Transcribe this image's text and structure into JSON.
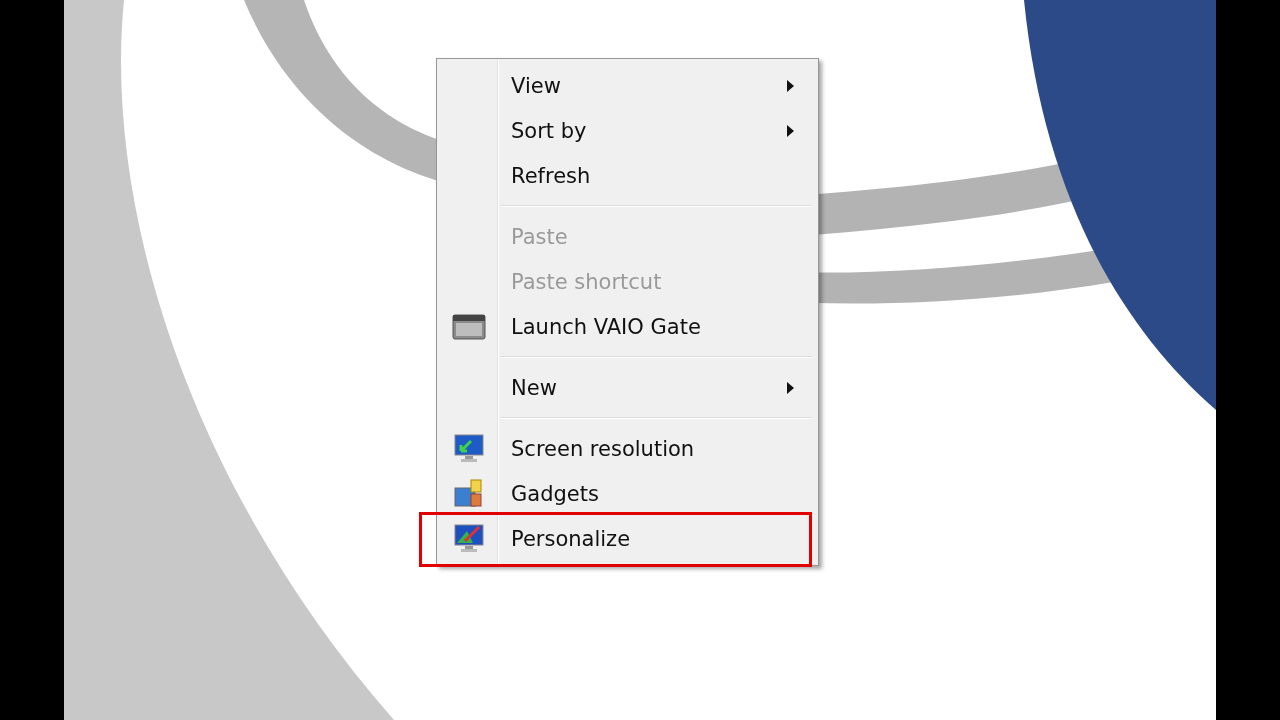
{
  "context_menu": {
    "items": [
      {
        "kind": "item",
        "label": "View",
        "submenu": true,
        "disabled": false,
        "highlighted": false
      },
      {
        "kind": "item",
        "label": "Sort by",
        "submenu": true,
        "disabled": false,
        "highlighted": false
      },
      {
        "kind": "item",
        "label": "Refresh",
        "submenu": false,
        "disabled": false,
        "highlighted": false
      },
      {
        "kind": "separator"
      },
      {
        "kind": "item",
        "label": "Paste",
        "submenu": false,
        "disabled": true,
        "highlighted": false
      },
      {
        "kind": "item",
        "label": "Paste shortcut",
        "submenu": false,
        "disabled": true,
        "highlighted": false
      },
      {
        "kind": "item",
        "label": "Launch VAIO Gate",
        "submenu": false,
        "disabled": false,
        "highlighted": false
      },
      {
        "kind": "separator"
      },
      {
        "kind": "item",
        "label": "New",
        "submenu": true,
        "disabled": false,
        "highlighted": false
      },
      {
        "kind": "separator"
      },
      {
        "kind": "item",
        "label": "Screen resolution",
        "submenu": false,
        "disabled": false,
        "highlighted": false
      },
      {
        "kind": "item",
        "label": "Gadgets",
        "submenu": false,
        "disabled": false,
        "highlighted": false
      },
      {
        "kind": "item",
        "label": "Personalize",
        "submenu": false,
        "disabled": false,
        "highlighted": true
      }
    ]
  }
}
